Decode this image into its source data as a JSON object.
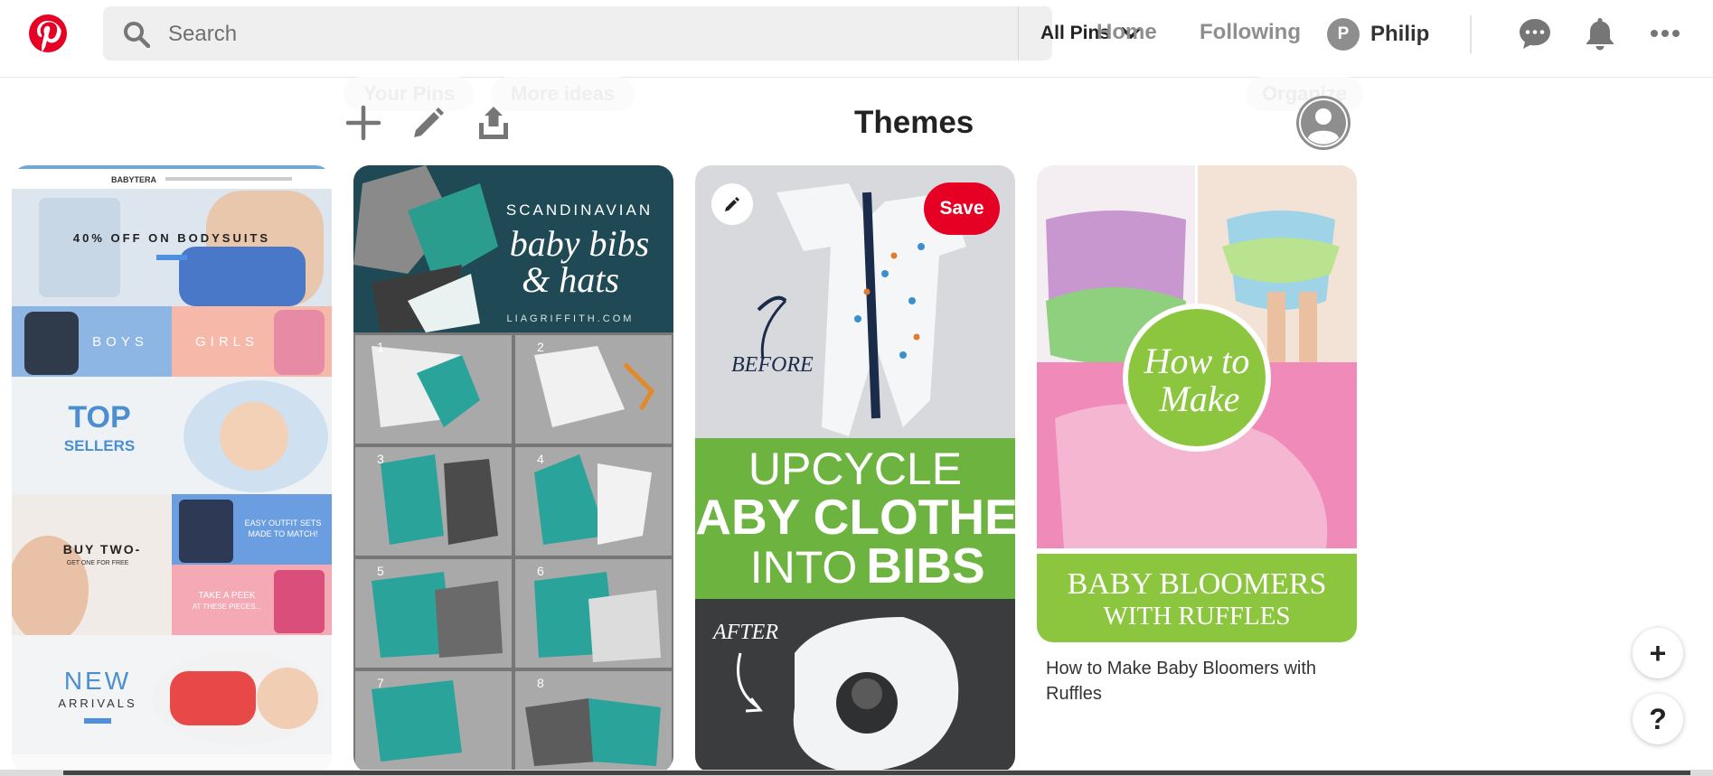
{
  "header": {
    "search_placeholder": "Search",
    "search_scope": "All Pins",
    "nav": {
      "home": "Home",
      "following": "Following"
    },
    "user": {
      "initial": "P",
      "name": "Philip"
    }
  },
  "subnav": {
    "tabs": [
      "Your Pins",
      "More ideas"
    ],
    "organize": "Organize"
  },
  "board": {
    "title": "Themes"
  },
  "pins": [
    {
      "texts": {
        "brand": "BABYTERA",
        "promo": "40% OFF ON BODYSUITS",
        "boys": "BOYS",
        "girls": "GIRLS",
        "top": "TOP",
        "sellers": "SELLERS",
        "buy": "BUY TWO-",
        "get": "GET ONE FOR FREE",
        "easy1": "EASY OUTFIT SETS",
        "easy2": "MADE TO MATCH!",
        "peek1": "TAKE A PEEK",
        "peek2": "AT THESE PIECES...",
        "new": "NEW",
        "arrivals": "ARRIVALS"
      }
    },
    {
      "texts": {
        "scandi": "SCANDINAVIAN",
        "bibs": "baby bibs",
        "hats": "& hats",
        "site": "LIAGRIFFITH.COM",
        "steps": [
          "1",
          "2",
          "3",
          "4",
          "5",
          "6",
          "7",
          "8"
        ]
      }
    },
    {
      "save_label": "Save",
      "texts": {
        "before": "BEFORE",
        "upcycle": "UPCYCLE",
        "baby_clothes": "BABY CLOTHES",
        "into": "INTO",
        "bibs": "BIBS",
        "after": "AFTER"
      }
    },
    {
      "texts": {
        "how": "How to",
        "make": "Make",
        "bloomers": "BABY BLOOMERS",
        "ruffles": "WITH RUFFLES"
      },
      "caption": "How to Make Baby Bloomers with Ruffles"
    }
  ],
  "floating": {
    "add": "+",
    "help": "?"
  },
  "colors": {
    "brand_red": "#e60023",
    "icon_gray": "#767676",
    "green": "#6db33f"
  }
}
